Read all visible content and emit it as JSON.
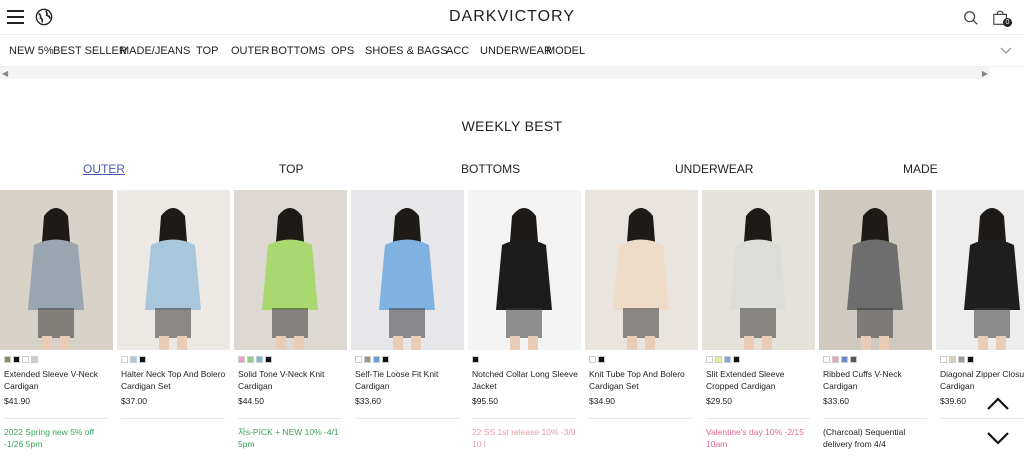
{
  "header": {
    "logo": "DARKVICTORY",
    "cart_count": "0"
  },
  "nav": {
    "items": [
      "NEW 5%",
      "BEST SELLER",
      "MADE/JEANS",
      "TOP",
      "OUTER",
      "BOTTOMS",
      "OPS",
      "SHOES & BAGS",
      "ACC",
      "UNDERWEAR",
      "MODEL"
    ]
  },
  "weekly_best": {
    "title": "WEEKLY BEST",
    "tabs": [
      {
        "label": "OUTER",
        "active": true
      },
      {
        "label": "TOP",
        "active": false
      },
      {
        "label": "BOTTOMS",
        "active": false
      },
      {
        "label": "UNDERWEAR",
        "active": false
      },
      {
        "label": "MADE",
        "active": false
      }
    ]
  },
  "products": [
    {
      "name": "Extended Sleeve V-Neck Cardigan",
      "price": "$41.90",
      "promo": "2022 Spring new 5% off -1/26 5pm",
      "promo_color": "#3aa55a",
      "swatches": [
        "#8a8a6a",
        "#111111",
        "#ffffff",
        "#cccccc"
      ],
      "bg": "#d9d2c8",
      "fig": "#9aa5b0"
    },
    {
      "name": "Halter Neck Top And Bolero Cardigan Set",
      "price": "$37.00",
      "promo": "",
      "promo_color": "#222222",
      "swatches": [
        "#ffffff",
        "#a8c8e0",
        "#111111"
      ],
      "bg": "#ece9e4",
      "fig": "#a9c7dc"
    },
    {
      "name": "Solid Tone V-Neck Knit Cardigan",
      "price": "$44.50",
      "promo": "자s-PICK + NEW 10% -4/1 5pm",
      "promo_color": "#3aa55a",
      "swatches": [
        "#e8a0c8",
        "#8fd08a",
        "#7ab8e0",
        "#111111"
      ],
      "bg": "#ddd8d2",
      "fig": "#a9d870"
    },
    {
      "name": "Self-Tie Loose Fit Knit Cardigan",
      "price": "$33.60",
      "promo": "",
      "promo_color": "#222222",
      "swatches": [
        "#ffffff",
        "#9a9a80",
        "#6aa0d8",
        "#111111"
      ],
      "bg": "#e7e7ea",
      "fig": "#7fb2e0"
    },
    {
      "name": "Notched Collar Long Sleeve Jacket",
      "price": "$95.50",
      "promo": "22 SS 1st release 10% -3/9 10 l",
      "promo_color": "#e89aa6",
      "swatches": [
        "#111111"
      ],
      "bg": "#f4f4f4",
      "fig": "#1c1c1c"
    },
    {
      "name": "Knit Tube Top And Bolero Cardigan Set",
      "price": "$34.90",
      "promo": "",
      "promo_color": "#222222",
      "swatches": [
        "#ffffff",
        "#111111"
      ],
      "bg": "#e9e4de",
      "fig": "#efdcc8"
    },
    {
      "name": "Slit Extended Sleeve Cropped Cardigan",
      "price": "$29.50",
      "promo": "Valentine's day 10% -2/15 10am",
      "promo_color": "#e06a8a",
      "swatches": [
        "#ffffff",
        "#e8ee9a",
        "#7aa8d8",
        "#111111"
      ],
      "bg": "#e5e2dc",
      "fig": "#dcdcd8"
    },
    {
      "name": "Ribbed Cuffs V-Neck Cardigan",
      "price": "$33.60",
      "promo": "(Charcoal) Sequential delivery from 4/4",
      "promo_color": "#222222",
      "swatches": [
        "#ffffff",
        "#e8a6b8",
        "#6a88c8",
        "#555555"
      ],
      "bg": "#cfc9c0",
      "fig": "#6e6e6e"
    },
    {
      "name": "Diagonal Zipper Closure Cardigan",
      "price": "$39.60",
      "promo": "",
      "promo_color": "#222222",
      "swatches": [
        "#ffffff",
        "#d8cfc0",
        "#999999",
        "#111111"
      ],
      "bg": "#ededed",
      "fig": "#1e1e1e"
    }
  ]
}
